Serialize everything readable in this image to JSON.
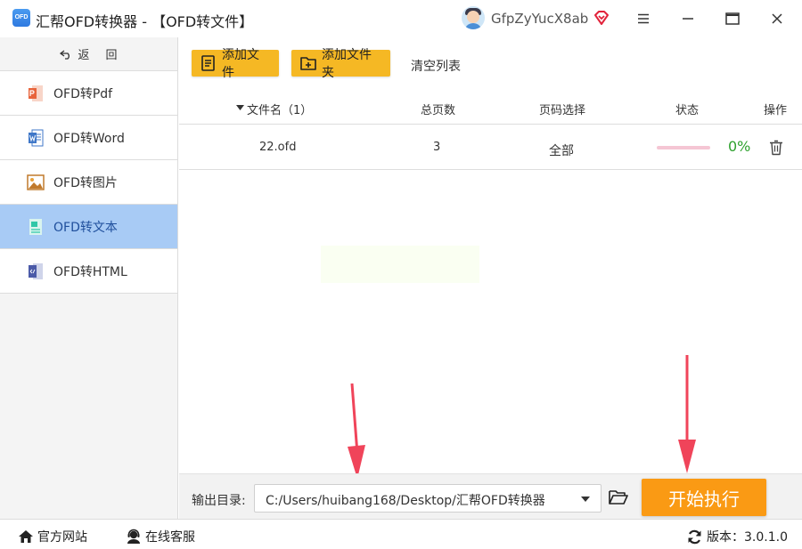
{
  "app": {
    "logo_text": "OFD",
    "title": "汇帮OFD转换器 - 【OFD转文件】",
    "username": "GfpZyYucX8ab"
  },
  "sidebar": {
    "back_label": "返 回",
    "items": [
      {
        "label": "OFD转Pdf",
        "icon": "pdf-icon"
      },
      {
        "label": "OFD转Word",
        "icon": "word-icon"
      },
      {
        "label": "OFD转图片",
        "icon": "image-icon"
      },
      {
        "label": "OFD转文本",
        "icon": "text-icon",
        "active": true
      },
      {
        "label": "OFD转HTML",
        "icon": "html-icon"
      }
    ]
  },
  "toolbar": {
    "add_file": "添加文件",
    "add_folder": "添加文件夹",
    "clear_list": "清空列表"
  },
  "table": {
    "headers": {
      "filename": "文件名（1）",
      "pages": "总页数",
      "page_select": "页码选择",
      "status": "状态",
      "action": "操作"
    },
    "rows": [
      {
        "filename": "22.ofd",
        "pages": "3",
        "page_select": "全部",
        "progress": 0,
        "progress_text": "0%"
      }
    ]
  },
  "output": {
    "label": "输出目录:",
    "path": "C:/Users/huibang168/Desktop/汇帮OFD转换器",
    "start_button": "开始执行"
  },
  "statusbar": {
    "website": "官方网站",
    "support": "在线客服",
    "version": "版本：3.0.1.0"
  },
  "colors": {
    "accent_yellow": "#f5b824",
    "start_orange": "#fa9a14",
    "active_nav": "#a8cbf5",
    "progress_green": "#2ea12e",
    "arrow_red": "#f0445a"
  }
}
